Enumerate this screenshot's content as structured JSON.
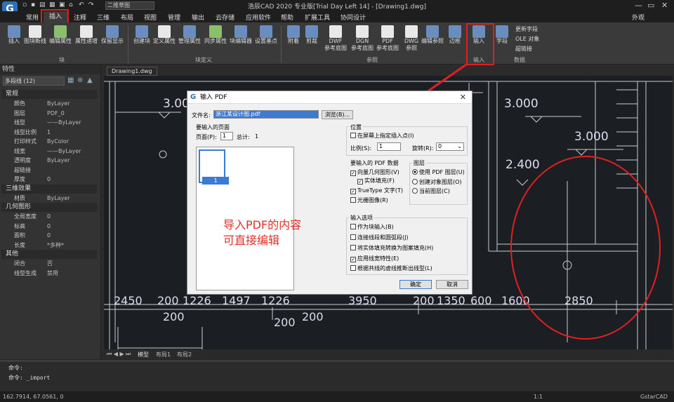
{
  "titlebar": {
    "title": "浩辰CAD 2020 专业版[Trial Day Left 14] - [Drawing1.dwg]",
    "workspace": "二维草图",
    "logo": "G"
  },
  "menu": {
    "items": [
      "常用",
      "插入",
      "注释",
      "三维",
      "布局",
      "视图",
      "管理",
      "输出",
      "云存储",
      "应用软件",
      "帮助",
      "扩展工具",
      "协同设计"
    ],
    "right": "外观"
  },
  "ribbon": {
    "block_group": {
      "label": "块",
      "buttons": [
        "插入",
        "图块断线",
        "编辑属性",
        "属性递增",
        "保留显示"
      ]
    },
    "block_def_group": {
      "label": "块定义",
      "buttons": [
        "创建块",
        "定义属性",
        "管理属性",
        "同步属性",
        "块编辑器",
        "设置基点"
      ]
    },
    "reference_group": {
      "label": "参照",
      "buttons": [
        "附着",
        "剪裁",
        "DWF\n参考底图",
        "DGN\n参考底图",
        "PDF\n参考底图",
        "DWG\n参照",
        "编辑参照",
        "边框"
      ]
    },
    "import_group": {
      "label": "输入",
      "button": "输入"
    },
    "data_group": {
      "label": "数据",
      "button": "字段",
      "side": [
        "更新字段",
        "OLE 对象",
        "超链接"
      ]
    }
  },
  "properties": {
    "title": "特性",
    "selector": "多段线 (12)",
    "categories": [
      {
        "name": "常规",
        "rows": [
          [
            "颜色",
            "ByLayer"
          ],
          [
            "图层",
            "PDF_0"
          ],
          [
            "线型",
            "——ByLayer"
          ],
          [
            "线型比例",
            "1"
          ],
          [
            "打印样式",
            "ByColor"
          ],
          [
            "线宽",
            "——ByLayer"
          ],
          [
            "透明度",
            "ByLayer"
          ],
          [
            "超链接",
            ""
          ],
          [
            "厚度",
            "0"
          ]
        ]
      },
      {
        "name": "三维效果",
        "rows": [
          [
            "材质",
            "ByLayer"
          ]
        ]
      },
      {
        "name": "几何图形",
        "rows": [
          [
            "全局宽度",
            "0"
          ],
          [
            "标高",
            "0"
          ],
          [
            "面积",
            "0"
          ],
          [
            "长度",
            "*多种*"
          ]
        ]
      },
      {
        "name": "其他",
        "rows": [
          [
            "闭合",
            "否"
          ],
          [
            "线型生成",
            "禁用"
          ]
        ]
      }
    ]
  },
  "document_tab": "Drawing1.dwg",
  "layout_tabs": [
    "模型",
    "布局1",
    "布局2"
  ],
  "canvas": {
    "dims": [
      "2450",
      "200",
      "1226",
      "1497",
      "1226",
      "3950",
      "200",
      "1350",
      "600",
      "1600",
      "2850"
    ],
    "dims2": [
      "200",
      "200",
      "200"
    ],
    "levels": [
      "3.00",
      "3.000",
      "3.000",
      "2.400"
    ]
  },
  "dialog": {
    "title": "输入 PDF",
    "file_label": "文件名:",
    "file_value": "浙江某设计图.pdf",
    "browse": "浏览(B)...",
    "pages_label": "要输入的页面",
    "page_label": "页面(P):",
    "page_value": "1",
    "total_label": "总计:",
    "total_value": "1",
    "thumb_num": "1",
    "position_label": "位置",
    "specify_on_screen": "在屏幕上指定插入点(I)",
    "scale_label": "比例(S):",
    "scale_value": "1",
    "rotation_label": "旋转(R):",
    "rotation_value": "0",
    "pdf_data_label": "要输入的 PDF 数据",
    "vector_geom": "向量几何图形(V)",
    "solid_fill": "实体填充(F)",
    "truetype": "TrueType 文字(T)",
    "raster": "光栅图像(R)",
    "layers_label": "图层",
    "use_pdf_layers": "使用 PDF 图层(U)",
    "create_obj_layers": "创建对象图层(O)",
    "current_layer": "当前图层(C)",
    "import_opts_label": "输入选项",
    "as_block": "作为块输入(B)",
    "join_lines": "连接线段和圆弧段(J)",
    "convert_hatch": "将实体填充转换为图案填充(H)",
    "apply_lineweight": "应用线宽特性(E)",
    "infer_linetypes": "根据共线的虚线推断出线型(L)",
    "ok": "确定",
    "cancel": "取消"
  },
  "overlay": {
    "line1": "导入PDF的内容",
    "line2": "可直接编辑"
  },
  "command": {
    "line1": "命令:",
    "line2": "命令: _import"
  },
  "status": {
    "coords": "162.7914, 67.0561, 0",
    "scale": "1:1",
    "brand": "GstarCAD"
  },
  "colors": {
    "annotation_red": "#e02020",
    "accent_blue": "#3b7bd4"
  }
}
